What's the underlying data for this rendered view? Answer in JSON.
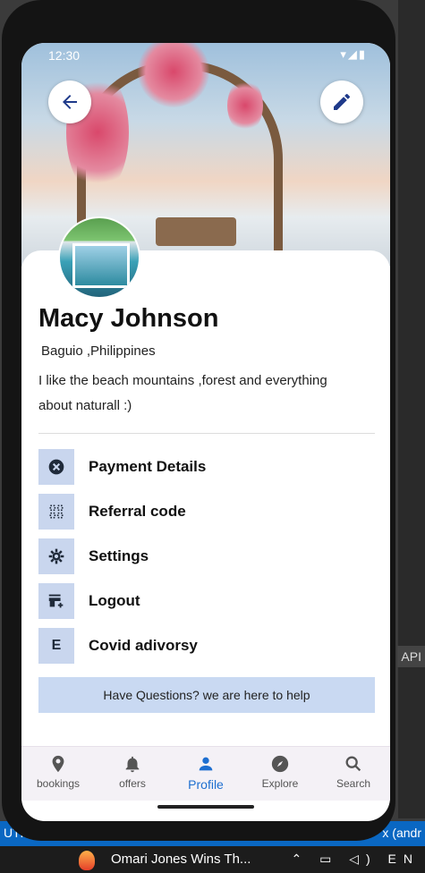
{
  "status": {
    "time": "12:30",
    "icons": "▾◢▮"
  },
  "header": {
    "back_label": "back",
    "edit_label": "edit"
  },
  "profile": {
    "name": "Macy Johnson",
    "location": "Baguio ,Philippines",
    "bio": "I like the beach mountains ,forest and everything about naturall :)"
  },
  "menu": [
    {
      "label": "Payment Details",
      "icon": "cancel-circle-icon"
    },
    {
      "label": "Referral code",
      "icon": "grid-icon"
    },
    {
      "label": "Settings",
      "icon": "gear-icon"
    },
    {
      "label": "Logout",
      "icon": "store-add-icon"
    },
    {
      "label": "Covid adivorsy",
      "icon": "letter-e-icon",
      "glyph": "E"
    }
  ],
  "help": {
    "text": "Have Questions? we are here to help"
  },
  "nav": [
    {
      "label": "bookings",
      "icon": "location-pin-icon"
    },
    {
      "label": "offers",
      "icon": "bell-icon"
    },
    {
      "label": "Profile",
      "icon": "person-icon",
      "active": true
    },
    {
      "label": "Explore",
      "icon": "compass-icon"
    },
    {
      "label": "Search",
      "icon": "search-icon"
    }
  ],
  "desktop": {
    "api_tag": "API",
    "uth_left": "UTF",
    "uth_right": "x (andr",
    "news_text": "Omari Jones Wins Th...",
    "tray_text": "⌃ ▭ ◁) EN"
  },
  "colors": {
    "accent": "#1e6fd0",
    "menu_icon_bg": "#c9d6ee",
    "help_bg": "#c9d9f2",
    "icon_dark": "#1f3a8a"
  }
}
